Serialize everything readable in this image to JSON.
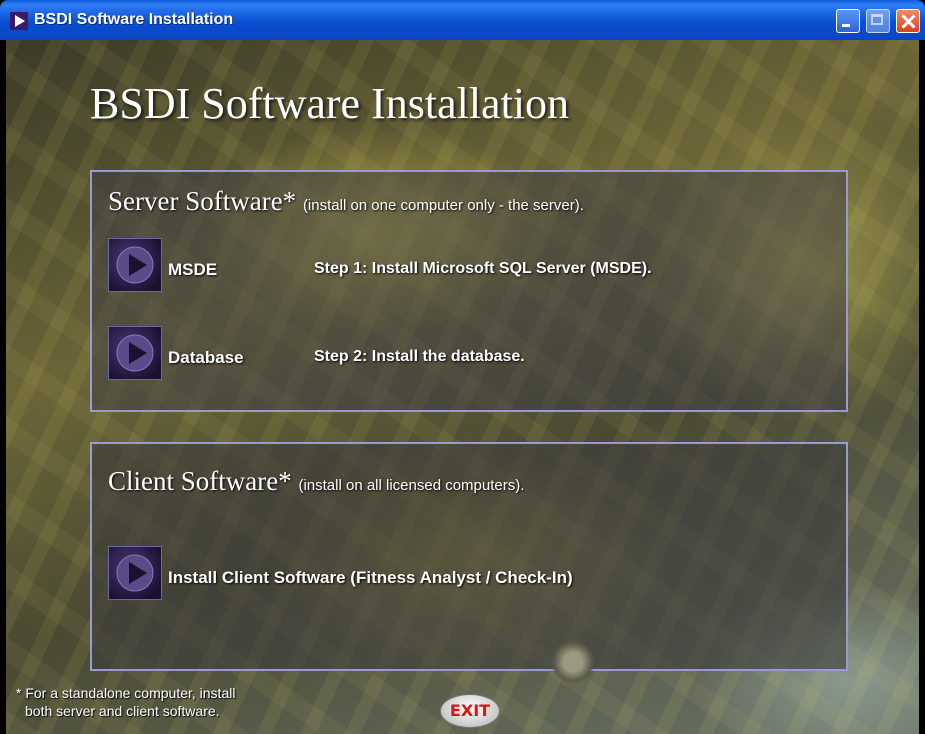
{
  "window": {
    "title": "BSDI Software Installation",
    "title_bar_color": "#0a4fd0"
  },
  "heading": "BSDI Software Installation",
  "server": {
    "title": "Server Software*",
    "note": "(install on one computer only - the server).",
    "items": [
      {
        "label": "MSDE",
        "step": "Step 1: Install Microsoft SQL Server (MSDE)."
      },
      {
        "label": "Database",
        "step": "Step 2: Install the database."
      }
    ]
  },
  "client": {
    "title": "Client Software*",
    "note": "(install on all licensed computers).",
    "install_label": "Install Client Software (Fitness Analyst / Check-In)"
  },
  "footnote": {
    "line1": "* For a standalone computer, install",
    "line2": "both server and client software."
  },
  "exit_label": "EXIT",
  "colors": {
    "panel_border": "#9a9ad2",
    "exit_text": "#d8161a",
    "button_bg": "#2a1a48"
  },
  "icons": {
    "title": "play-icon",
    "buttons": "play-arrow-icon"
  }
}
